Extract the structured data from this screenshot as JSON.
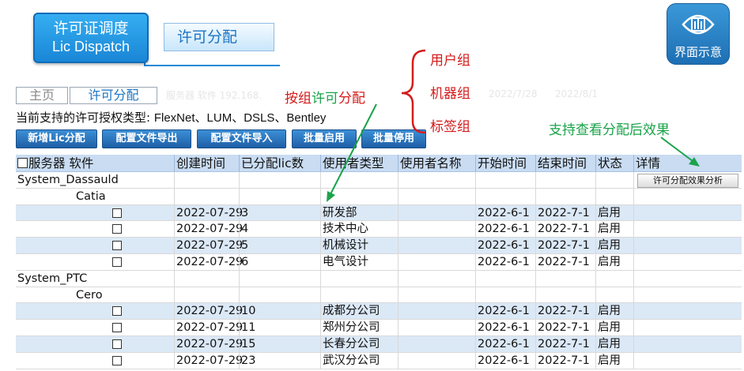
{
  "title": {
    "cn": "许可证调度",
    "en": "Lic Dispatch",
    "sub": "许可分配"
  },
  "view_icon": {
    "label": "界面示意",
    "icon": "eye-window-icon"
  },
  "tabs": [
    {
      "label": "主页"
    },
    {
      "label": "许可分配"
    }
  ],
  "background_text": {
    "a": "服务器 软件 192.168.",
    "b": "2022/7/28",
    "c": "2022/8/1"
  },
  "support": {
    "prefix": "当前支持的许可授权类型:",
    "types": "FlexNet、LUM、DSLS、Bentley"
  },
  "buttons": [
    "新增Lic分配",
    "配置文件导出",
    "配置文件导入",
    "批量启用",
    "批量停用"
  ],
  "annotations": {
    "by_prefix": "按组",
    "by_middle": "许可",
    "by_suffix": "分配",
    "groups": [
      "用户组",
      "机器组",
      "标签组"
    ],
    "view_effect": "支持查看分配后效果"
  },
  "table": {
    "headers": [
      "服务器 软件",
      "创建时间",
      "已分配lic数",
      "使用者类型",
      "使用者名称",
      "开始时间",
      "结束时间",
      "状态",
      "详情"
    ],
    "analyze_button": "许可分配效果分析",
    "servers": [
      {
        "name": "System_Dassauld",
        "software": "Catia",
        "rows": [
          {
            "created": "2022-07-29",
            "count": "3",
            "user_type": "研发部",
            "start": "2022-6-1",
            "end": "2022-7-1",
            "status": "启用"
          },
          {
            "created": "2022-07-29",
            "count": "4",
            "user_type": "技术中心",
            "start": "2022-6-1",
            "end": "2022-7-1",
            "status": "启用"
          },
          {
            "created": "2022-07-29",
            "count": "5",
            "user_type": "机械设计",
            "start": "2022-6-1",
            "end": "2022-7-1",
            "status": "启用"
          },
          {
            "created": "2022-07-29",
            "count": "6",
            "user_type": "电气设计",
            "start": "2022-6-1",
            "end": "2022-7-1",
            "status": "启用"
          }
        ]
      },
      {
        "name": "System_PTC",
        "software": "Cero",
        "rows": [
          {
            "created": "2022-07-29",
            "count": "10",
            "user_type": "成都分公司",
            "start": "2022-6-1",
            "end": "2022-7-1",
            "status": "启用"
          },
          {
            "created": "2022-07-29",
            "count": "11",
            "user_type": "郑州分公司",
            "start": "2022-6-1",
            "end": "2022-7-1",
            "status": "启用"
          },
          {
            "created": "2022-07-29",
            "count": "15",
            "user_type": "长春分公司",
            "start": "2022-6-1",
            "end": "2022-7-1",
            "status": "启用"
          },
          {
            "created": "2022-07-29",
            "count": "23",
            "user_type": "武汉分公司",
            "start": "2022-6-1",
            "end": "2022-7-1",
            "status": "启用"
          }
        ]
      }
    ]
  },
  "colors": {
    "accent_blue": "#1b74c2",
    "annotation_red": "#d41c1c",
    "annotation_green": "#1aa34a",
    "row_alt": "#dbe8f6",
    "header_bg": "#c9dcf2"
  }
}
